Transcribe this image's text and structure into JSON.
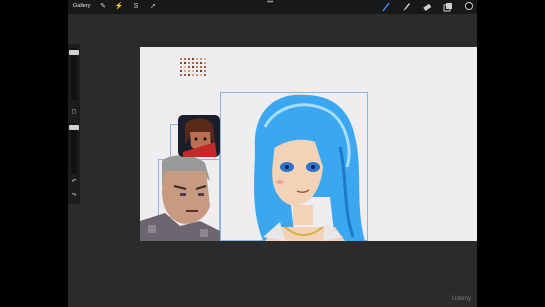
{
  "toolbar": {
    "gallery_label": "Gallery",
    "left_tools": [
      "wrench-icon",
      "magic-wand-icon",
      "selection-icon",
      "transform-icon"
    ],
    "right_tools": [
      "brush-icon",
      "smudge-icon",
      "eraser-icon",
      "layers-icon"
    ],
    "more_label": "•••",
    "color_value": "#000000",
    "accent": "#3d8bff"
  },
  "sidebar": {
    "modify_label": "◻",
    "undo_label": "↶",
    "redo_label": "↷"
  },
  "canvas": {
    "background": "#efedf0",
    "palette_colors": [
      "#c7805a",
      "#b86848",
      "#9a5540",
      "#7a4030",
      "#d9a07a",
      "#c69070",
      "#e6b090",
      "#8c5a46",
      "#5a3a30"
    ]
  },
  "watermark": {
    "text": "Udemy"
  }
}
